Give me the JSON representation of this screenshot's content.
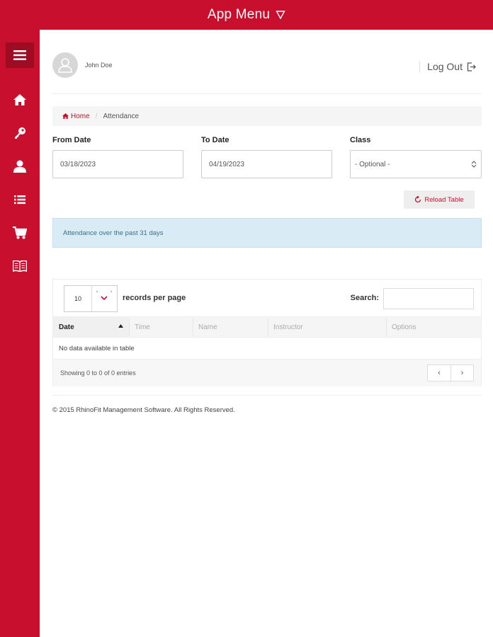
{
  "topbar": {
    "title": "App Menu"
  },
  "user": {
    "name": "John Doe",
    "logout_label": "Log Out"
  },
  "breadcrumb": {
    "home": "Home",
    "current": "Attendance"
  },
  "filters": {
    "from_label": "From Date",
    "from_value": "03/18/2023",
    "to_label": "To Date",
    "to_value": "04/19/2023",
    "class_label": "Class",
    "class_value": "- Optional -"
  },
  "reload_label": "Reload Table",
  "info_text": "Attendance over the past 31 days",
  "table": {
    "length_value": "10",
    "records_per_page": "records per page",
    "search_label": "Search:",
    "columns": [
      "Date",
      "Time",
      "Name",
      "Instructor",
      "Options"
    ],
    "empty": "No data available in table",
    "info": "Showing 0 to 0 of 0 entries",
    "prev": "‹",
    "next": "›"
  },
  "footer": "© 2015 RhinoFit Management Software. All Rights Reserved.",
  "colors": {
    "brand": "#c8102e",
    "info_bg": "#d9ecf5"
  }
}
